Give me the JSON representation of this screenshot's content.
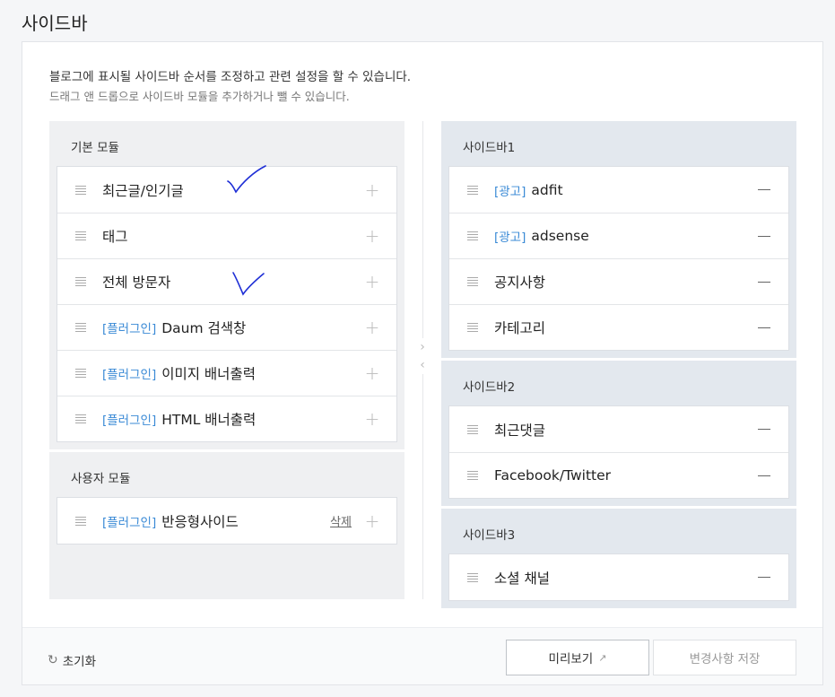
{
  "page_title": "사이드바",
  "description": {
    "line1": "블로그에 표시될 사이드바 순서를 조정하고 관련 설정을 할 수 있습니다.",
    "line2": "드래그 앤 드롭으로 사이드바 모듈을 추가하거나 뺄 수 있습니다."
  },
  "basic_modules": {
    "title": "기본 모듈",
    "items": [
      {
        "tag": "",
        "label": "최근글/인기글"
      },
      {
        "tag": "",
        "label": "태그"
      },
      {
        "tag": "",
        "label": "전체 방문자"
      },
      {
        "tag": "[플러그인]",
        "label": "Daum 검색창"
      },
      {
        "tag": "[플러그인]",
        "label": "이미지 배너출력"
      },
      {
        "tag": "[플러그인]",
        "label": "HTML 배너출력"
      }
    ]
  },
  "user_modules": {
    "title": "사용자 모듈",
    "items": [
      {
        "tag": "[플러그인]",
        "label": "반응형사이드",
        "delete_label": "삭제"
      }
    ]
  },
  "sidebar1": {
    "title": "사이드바1",
    "items": [
      {
        "tag": "[광고]",
        "label": "adfit"
      },
      {
        "tag": "[광고]",
        "label": "adsense"
      },
      {
        "tag": "",
        "label": "공지사항"
      },
      {
        "tag": "",
        "label": "카테고리"
      }
    ]
  },
  "sidebar2": {
    "title": "사이드바2",
    "items": [
      {
        "tag": "",
        "label": "최근댓글"
      },
      {
        "tag": "",
        "label": "Facebook/Twitter"
      }
    ]
  },
  "sidebar3": {
    "title": "사이드바3",
    "items": [
      {
        "tag": "",
        "label": "소셜 채널"
      }
    ]
  },
  "footer": {
    "reset_label": "초기화",
    "preview_label": "미리보기",
    "save_label": "변경사항 저장"
  },
  "icons": {
    "handle": "drag-handle-icon",
    "add": "plus-icon",
    "remove": "minus-icon",
    "reset": "refresh-icon",
    "external": "external-link-icon",
    "move_right": "chevron-right-icon",
    "move_left": "chevron-left-icon"
  },
  "colors": {
    "tag_blue": "#3a8ad6",
    "annotation_ink": "#1f2fd6",
    "sidebar_group_bg": "#e3e8ee",
    "module_group_bg": "#eff0f2"
  }
}
